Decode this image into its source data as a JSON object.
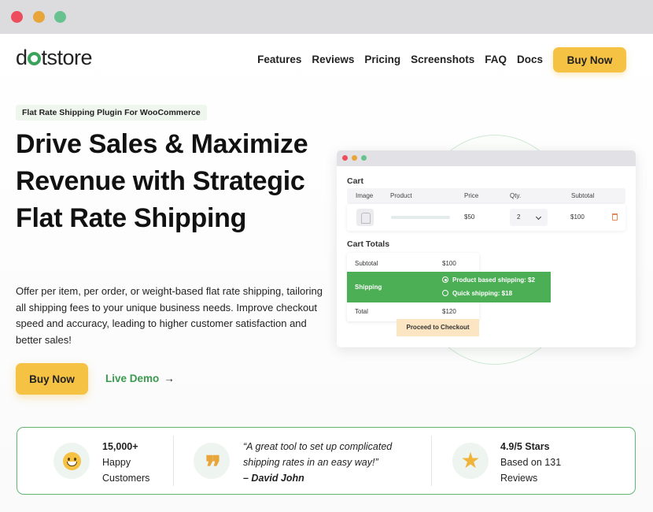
{
  "header": {
    "logo": "dotstore",
    "nav": [
      "Features",
      "Reviews",
      "Pricing",
      "Screenshots",
      "FAQ",
      "Docs"
    ],
    "cta": "Buy Now"
  },
  "hero": {
    "badge": "Flat Rate Shipping Plugin For WooCommerce",
    "headline": "Drive Sales & Maximize Revenue with Strategic Flat Rate Shipping",
    "description": "Offer per item, per order, or weight-based flat rate shipping, tailoring all shipping fees to your unique business needs. Improve checkout speed and accuracy, leading to higher customer satisfaction and better sales!",
    "buy_label": "Buy Now",
    "demo_label": "Live Demo",
    "demo_arrow": "→"
  },
  "mockup": {
    "cart_title": "Cart",
    "columns": [
      "Image",
      "Product",
      "Price",
      "Qty.",
      "Subtotal"
    ],
    "row": {
      "price": "$50",
      "qty": "2",
      "subtotal": "$100"
    },
    "totals_title": "Cart Totals",
    "subtotal_label": "Subtotal",
    "subtotal_value": "$100",
    "shipping_label": "Shipping",
    "shipping_options": [
      "Product based shipping: $2",
      "Quick shipping: $18"
    ],
    "total_label": "Total",
    "total_value": "$120",
    "checkout_label": "Proceed to Checkout"
  },
  "stats": {
    "customers_count": "15,000+",
    "customers_line1": "Happy",
    "customers_line2": "Customers",
    "quote_line1": "“A great tool to set up complicated",
    "quote_line2": "shipping rates in an easy way!”",
    "quote_author": "– David John",
    "rating": "4.9/5 Stars",
    "rating_line1": "Based on 131",
    "rating_line2": "Reviews"
  },
  "icons": {
    "customers": "smiley-icon",
    "quote": "quote-icon",
    "rating": "star-icon"
  },
  "colors": {
    "accent_yellow": "#f5c244",
    "brand_green": "#3aa35b",
    "shipping_green": "#4caf55"
  }
}
